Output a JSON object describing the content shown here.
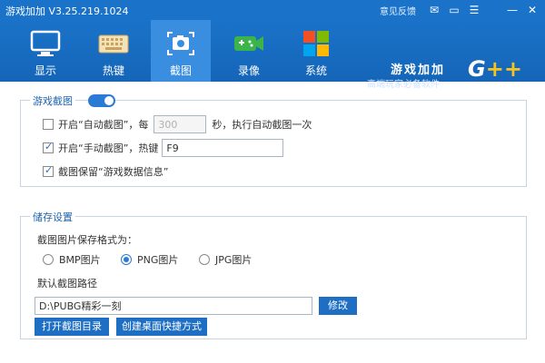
{
  "window": {
    "title": "游戏加加 V3.25.219.1024",
    "feedback_label": "意见反馈",
    "controls": [
      "mail-icon",
      "skin-icon",
      "minimize-icon",
      "close-icon"
    ]
  },
  "nav": {
    "tabs": [
      {
        "label": "显示",
        "icon": "monitor-icon"
      },
      {
        "label": "热键",
        "icon": "keyboard-icon"
      },
      {
        "label": "截图",
        "icon": "camera-icon",
        "active": true
      },
      {
        "label": "录像",
        "icon": "gamepad-video-icon"
      },
      {
        "label": "系统",
        "icon": "windows-icon"
      }
    ],
    "active_color": "#3a8ee0"
  },
  "brand": {
    "name": "游戏加加",
    "tagline": "高端玩家必备软件",
    "logo_text": "G",
    "logo_plus": "++"
  },
  "screenshot_panel": {
    "title": "游戏截图",
    "enabled": true,
    "auto_capture": {
      "checked": false,
      "label_pre": "开启“自动截图”，每",
      "value": "300",
      "label_post": "秒，执行自动截图一次"
    },
    "manual_capture": {
      "checked": true,
      "label": "开启“手动截图”，热键",
      "hotkey": "F9"
    },
    "keep_info": {
      "checked": true,
      "label": "截图保留“游戏数据信息”"
    }
  },
  "storage_panel": {
    "title": "储存设置",
    "format_label": "截图图片保存格式为：",
    "formats": [
      {
        "label": "BMP图片",
        "checked": false
      },
      {
        "label": "PNG图片",
        "checked": true
      },
      {
        "label": "JPG图片",
        "checked": false
      }
    ],
    "path_label": "默认截图路径",
    "path_value": "D:\\PUBG精彩一刻",
    "modify_button": "修改",
    "open_dir_button": "打开截图目录",
    "shortcut_button": "创建桌面快捷方式"
  }
}
